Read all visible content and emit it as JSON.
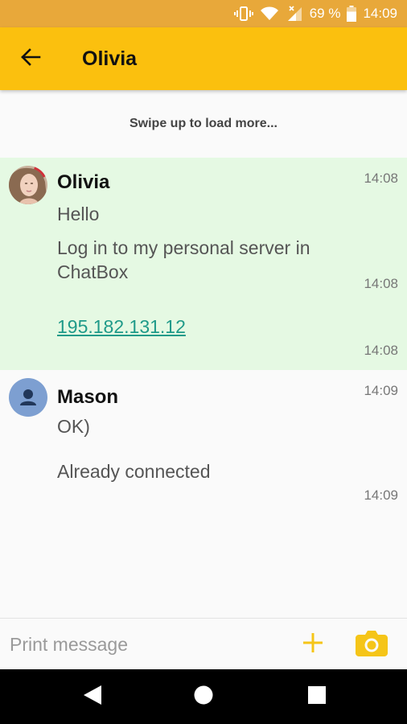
{
  "status_bar": {
    "battery": "69 %",
    "time": "14:09",
    "icons": [
      "vibrate-icon",
      "wifi-icon",
      "signal-icon",
      "battery-icon"
    ]
  },
  "app_bar": {
    "title": "Olivia",
    "back_icon": "back-arrow-icon"
  },
  "load_more_text": "Swipe up to load more...",
  "conversation": {
    "olivia": {
      "sender": "Olivia",
      "time": "14:08",
      "messages": [
        {
          "text": "Hello",
          "time": ""
        },
        {
          "text": "Log in to my personal server in ChatBox",
          "line1": "Log in to my personal server in",
          "line2": "ChatBox",
          "time": "14:08"
        },
        {
          "text": "195.182.131.12",
          "time": "14:08"
        }
      ]
    },
    "mason": {
      "sender": "Mason",
      "time": "14:09",
      "messages": [
        {
          "text": "OK)",
          "time": ""
        },
        {
          "text": "Already connected",
          "time": "14:09"
        }
      ]
    }
  },
  "composer": {
    "placeholder": "Print message",
    "add_icon": "plus-icon",
    "camera_icon": "camera-icon"
  },
  "nav_bar": {
    "icons": [
      "back-triangle-icon",
      "home-circle-icon",
      "recents-square-icon"
    ]
  },
  "colors": {
    "status_bar": "#e8a83a",
    "app_bar": "#fbc00e",
    "accent": "#f5c518",
    "incoming_bg": "#e5f9e3",
    "link": "#1f9a89",
    "mason_avatar": "#7d9fd1"
  }
}
